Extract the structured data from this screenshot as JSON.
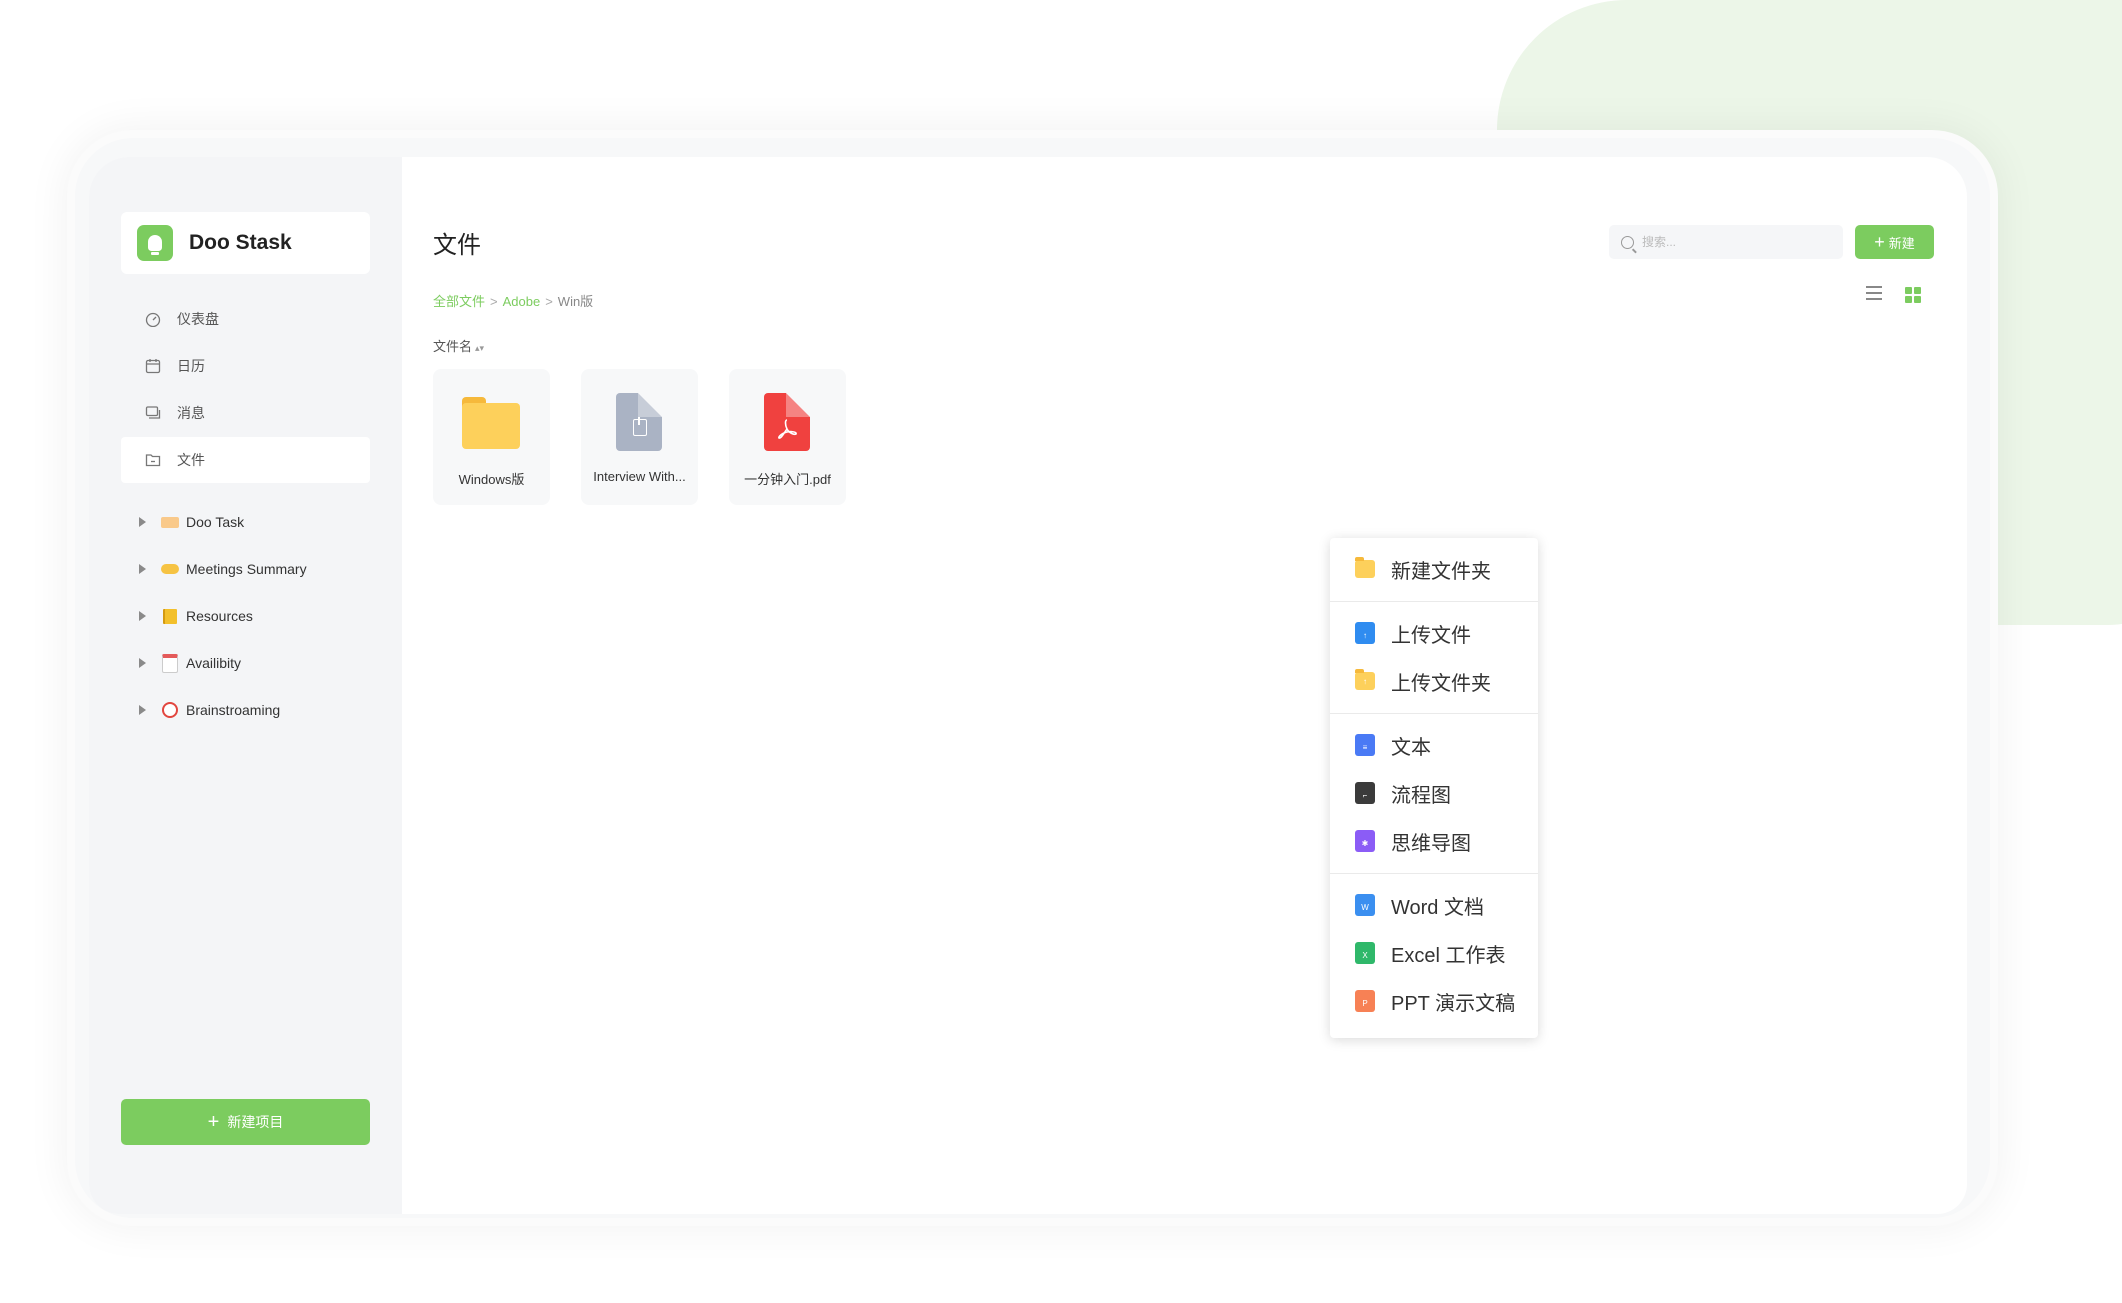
{
  "colors": {
    "accent": "#7ccc5f",
    "pdf": "#f0413f",
    "zip": "#aab3c4",
    "folder": "#fdd05b"
  },
  "app": {
    "name": "Doo Stask"
  },
  "sidebar": {
    "nav": [
      {
        "label": "仪表盘",
        "icon": "dashboard-icon"
      },
      {
        "label": "日历",
        "icon": "calendar-icon"
      },
      {
        "label": "消息",
        "icon": "message-icon"
      },
      {
        "label": "文件",
        "icon": "file-icon",
        "active": true
      }
    ],
    "projects": [
      {
        "label": "Doo Task",
        "emoji": "🏷️"
      },
      {
        "label": "Meetings Summary",
        "emoji": "🤝"
      },
      {
        "label": "Resources",
        "emoji": "📒"
      },
      {
        "label": "Availibity",
        "emoji": "📅"
      },
      {
        "label": "Brainstroaming",
        "emoji": "⏰"
      }
    ],
    "new_project_label": "新建项目"
  },
  "main": {
    "title": "文件",
    "breadcrumb": [
      "全部文件",
      "Adobe",
      "Win版"
    ],
    "search_placeholder": "搜索...",
    "new_label": "新建",
    "sort_label": "文件名",
    "files": [
      {
        "name": "Windows版",
        "type": "folder"
      },
      {
        "name": "Interview With...",
        "type": "zip"
      },
      {
        "name": "一分钟入门.pdf",
        "type": "pdf"
      }
    ]
  },
  "context_menu": {
    "items": [
      {
        "label": "新建文件夹",
        "icon": "new-folder-icon",
        "color": "#fdd05b"
      },
      {
        "label": "上传文件",
        "icon": "upload-file-icon",
        "color": "#2f8cf0"
      },
      {
        "label": "上传文件夹",
        "icon": "upload-folder-icon",
        "color": "#fdd05b"
      },
      {
        "label": "文本",
        "icon": "text-doc-icon",
        "color": "#4a7af5"
      },
      {
        "label": "流程图",
        "icon": "flowchart-icon",
        "color": "#3b3b3b"
      },
      {
        "label": "思维导图",
        "icon": "mindmap-icon",
        "color": "#8b5cf6"
      },
      {
        "label": "Word 文档",
        "icon": "word-icon",
        "color": "#3b8ff0"
      },
      {
        "label": "Excel 工作表",
        "icon": "excel-icon",
        "color": "#2fb86a"
      },
      {
        "label": "PPT 演示文稿",
        "icon": "ppt-icon",
        "color": "#f78155"
      }
    ]
  }
}
